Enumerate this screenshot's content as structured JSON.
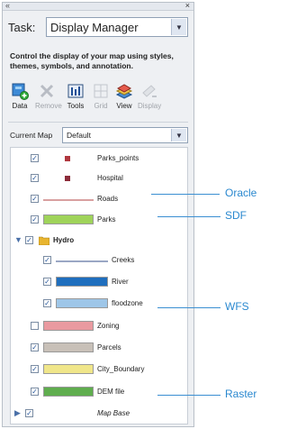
{
  "task": {
    "label": "Task:",
    "value": "Display Manager"
  },
  "description": "Control the display of your map using styles, themes, symbols, and annotation.",
  "toolbar": [
    {
      "label": "Data",
      "icon": "add-data-icon",
      "enabled": true
    },
    {
      "label": "Remove",
      "icon": "remove-x-icon",
      "enabled": false
    },
    {
      "label": "Tools",
      "icon": "tools-icon",
      "enabled": true
    },
    {
      "label": "Grid",
      "icon": "grid-icon",
      "enabled": false
    },
    {
      "label": "View",
      "icon": "view-icon",
      "enabled": true
    },
    {
      "label": "Display",
      "icon": "display-icon",
      "enabled": false
    }
  ],
  "current_map": {
    "label": "Current Map",
    "value": "Default"
  },
  "layers": [
    {
      "name": "Parks_points",
      "checked": true,
      "symbol": "point",
      "color": "#b0383f"
    },
    {
      "name": "Hospital",
      "checked": true,
      "symbol": "point",
      "color": "#8c2c3a"
    },
    {
      "name": "Roads",
      "checked": true,
      "symbol": "line",
      "color": "#d9a0a0"
    },
    {
      "name": "Parks",
      "checked": true,
      "symbol": "poly",
      "color": "#9fd35a"
    },
    {
      "name": "Hydro",
      "checked": true,
      "symbol": "group",
      "color": "#e8b530"
    },
    {
      "name": "Creeks",
      "checked": true,
      "symbol": "line",
      "color": "#9aa7c4"
    },
    {
      "name": "River",
      "checked": true,
      "symbol": "poly",
      "color": "#1f6ebd"
    },
    {
      "name": "floodzone",
      "checked": true,
      "symbol": "poly",
      "color": "#9ec6e8"
    },
    {
      "name": "Zoning",
      "checked": false,
      "symbol": "poly",
      "color": "#e99aa0"
    },
    {
      "name": "Parcels",
      "checked": true,
      "symbol": "poly",
      "color": "#c8c0b8"
    },
    {
      "name": "City_Boundary",
      "checked": true,
      "symbol": "poly",
      "color": "#f0e68a"
    },
    {
      "name": "DEM file",
      "checked": true,
      "symbol": "poly",
      "color": "#5fad4e"
    },
    {
      "name": "Map Base",
      "checked": true,
      "symbol": "group-collapsed",
      "color": ""
    }
  ],
  "callouts": [
    {
      "label": "Oracle"
    },
    {
      "label": "SDF"
    },
    {
      "label": "WFS"
    },
    {
      "label": "Raster"
    }
  ]
}
